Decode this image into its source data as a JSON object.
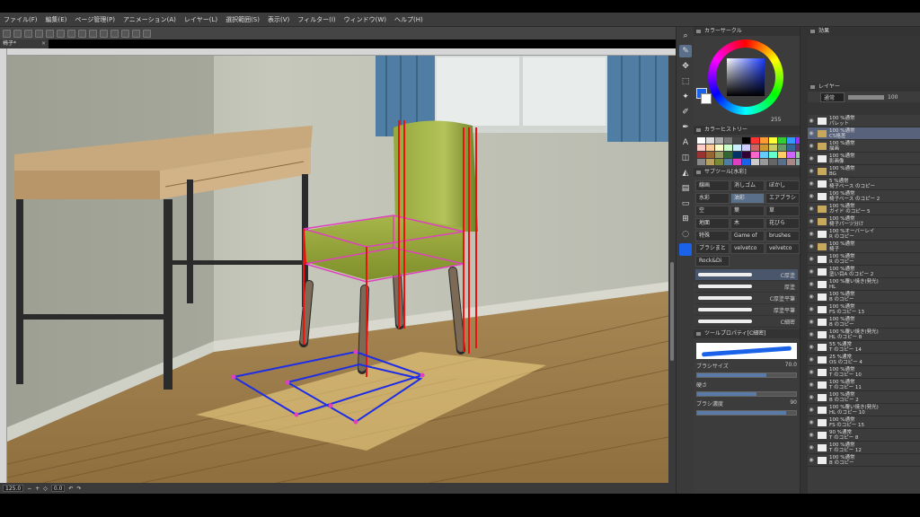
{
  "menu": [
    "ファイル(F)",
    "編集(E)",
    "ページ管理(P)",
    "アニメーション(A)",
    "レイヤー(L)",
    "選択範囲(S)",
    "表示(V)",
    "フィルター(I)",
    "ウィンドウ(W)",
    "ヘルプ(H)"
  ],
  "doc_tab": {
    "title": "椅子*",
    "close": "×"
  },
  "status": {
    "zoom": "125.0",
    "angle": "0.0"
  },
  "color_wheel": {
    "title": "カラーサークル",
    "value": "255",
    "main_color": "#1a62e8",
    "sub_color": "#ffffff"
  },
  "palette": {
    "title": "カラーヒストリー"
  },
  "subtool": {
    "title": "サブツール[水彩]",
    "groups": [
      "線画",
      "消しゴム",
      "ぼかし",
      "水彩",
      "油彩",
      "エアブラシ",
      "空",
      "葉",
      "草",
      "地面",
      "木",
      "花びら",
      "特殊",
      "Game of",
      "brushes",
      "ブラシまと",
      "velvetco",
      "velvetco",
      "Rock&Di"
    ],
    "brushes": [
      "C厚塗",
      "厚塗",
      "C厚塗平筆",
      "厚塗平筆",
      "C細密"
    ]
  },
  "tool_property": {
    "title": "ツールプロパティ[C細密]",
    "brush_size_label": "ブラシサイズ",
    "brush_size": "70.0",
    "hardness_label": "硬さ",
    "density_label": "ブラシ濃度",
    "density": "90"
  },
  "effects": {
    "label": "効果"
  },
  "layer_panel": {
    "title": "レイヤー",
    "blend": "通常",
    "opacity": "100",
    "layers": [
      {
        "name": "100 %通常\nパレット",
        "sel": false,
        "folder": false
      },
      {
        "name": "100 %通常\nC5格差",
        "sel": true,
        "folder": true
      },
      {
        "name": "100 %通常\n描画",
        "sel": false,
        "folder": true
      },
      {
        "name": "100 %通常\n影画像",
        "sel": false,
        "folder": false
      },
      {
        "name": "100 %通常\nBG",
        "sel": false,
        "folder": true
      },
      {
        "name": "5 %通常\n椅子ベース のコピー",
        "sel": false,
        "folder": false
      },
      {
        "name": "100 %通常\n椅子ベース のコピー 2",
        "sel": false,
        "folder": false
      },
      {
        "name": "100 %通常\nガイド のコピー 5",
        "sel": false,
        "folder": true
      },
      {
        "name": "100 %通常\n椅子パーツ分け",
        "sel": false,
        "folder": true
      },
      {
        "name": "100 %オーバーレイ\nR のコピー",
        "sel": false,
        "folder": false
      },
      {
        "name": "100 %通常\n椅子",
        "sel": false,
        "folder": true
      },
      {
        "name": "100 %通常\nR のコピー",
        "sel": false,
        "folder": false
      },
      {
        "name": "100 %通常\n塗い目A のコピー 2",
        "sel": false,
        "folder": false
      },
      {
        "name": "100 %覆い焼き(発光)\nHL",
        "sel": false,
        "folder": false
      },
      {
        "name": "100 %通常\nB のコピー",
        "sel": false,
        "folder": false
      },
      {
        "name": "100 %通常\nFS のコピー 13",
        "sel": false,
        "folder": false
      },
      {
        "name": "100 %通常\nB のコピー",
        "sel": false,
        "folder": false
      },
      {
        "name": "100 %覆い焼き(発光)\nHL のコピー 8",
        "sel": false,
        "folder": false
      },
      {
        "name": "55 %通常\nT のコピー 14",
        "sel": false,
        "folder": false
      },
      {
        "name": "25 %通常\nOS のコピー 4",
        "sel": false,
        "folder": false
      },
      {
        "name": "100 %通常\nT のコピー 10",
        "sel": false,
        "folder": false
      },
      {
        "name": "100 %通常\nT のコピー 11",
        "sel": false,
        "folder": false
      },
      {
        "name": "100 %通常\nB のコピー 2",
        "sel": false,
        "folder": false
      },
      {
        "name": "100 %覆い焼き(発光)\nHL のコピー 10",
        "sel": false,
        "folder": false
      },
      {
        "name": "100 %通常\nFS のコピー 15",
        "sel": false,
        "folder": false
      },
      {
        "name": "90 %通常\nT のコピー 8",
        "sel": false,
        "folder": false
      },
      {
        "name": "100 %通常\nT のコピー 12",
        "sel": false,
        "folder": false
      },
      {
        "name": "100 %通常\nB のコピー",
        "sel": false,
        "folder": false
      }
    ]
  }
}
